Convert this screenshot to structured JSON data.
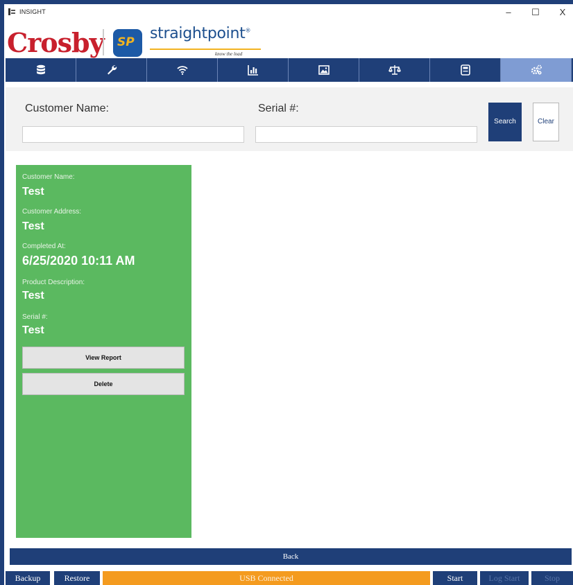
{
  "window": {
    "title": "INSIGHT",
    "controls": {
      "minimize": "–",
      "maximize": "☐",
      "close": "X"
    }
  },
  "brand": {
    "crosby": "Crosby",
    "sp_badge": "SP",
    "name": "straightpoint",
    "trademark": "®",
    "tagline": "know the load"
  },
  "nav": {
    "tabs": [
      {
        "icon": "database-icon"
      },
      {
        "icon": "wrench-icon"
      },
      {
        "icon": "wifi-icon"
      },
      {
        "icon": "bar-chart-icon"
      },
      {
        "icon": "image-icon"
      },
      {
        "icon": "scale-icon"
      },
      {
        "icon": "calculator-icon"
      },
      {
        "icon": "gears-icon",
        "active": true
      }
    ]
  },
  "search": {
    "customer_label": "Customer Name:",
    "customer_value": "",
    "serial_label": "Serial #:",
    "serial_value": "",
    "search_button": "Search",
    "clear_button": "Clear"
  },
  "result": {
    "fields": [
      {
        "label": "Customer Name:",
        "value": "Test"
      },
      {
        "label": "Customer Address:",
        "value": "Test"
      },
      {
        "label": "Completed At:",
        "value": "6/25/2020 10:11 AM"
      },
      {
        "label": "Product Description:",
        "value": "Test"
      },
      {
        "label": "Serial #:",
        "value": "Test"
      }
    ],
    "view_report_button": "View Report",
    "delete_button": "Delete"
  },
  "back_button": "Back",
  "status_bar": {
    "backup": "Backup",
    "restore": "Restore",
    "connection": "USB Connected",
    "start": "Start",
    "log_start": "Log Start",
    "stop": "Stop"
  },
  "colors": {
    "nav_blue": "#1f3f78",
    "active_tab": "#7f9cd3",
    "card_green": "#5bb960",
    "status_orange": "#f49b1f",
    "crosby_red": "#c8202d"
  }
}
